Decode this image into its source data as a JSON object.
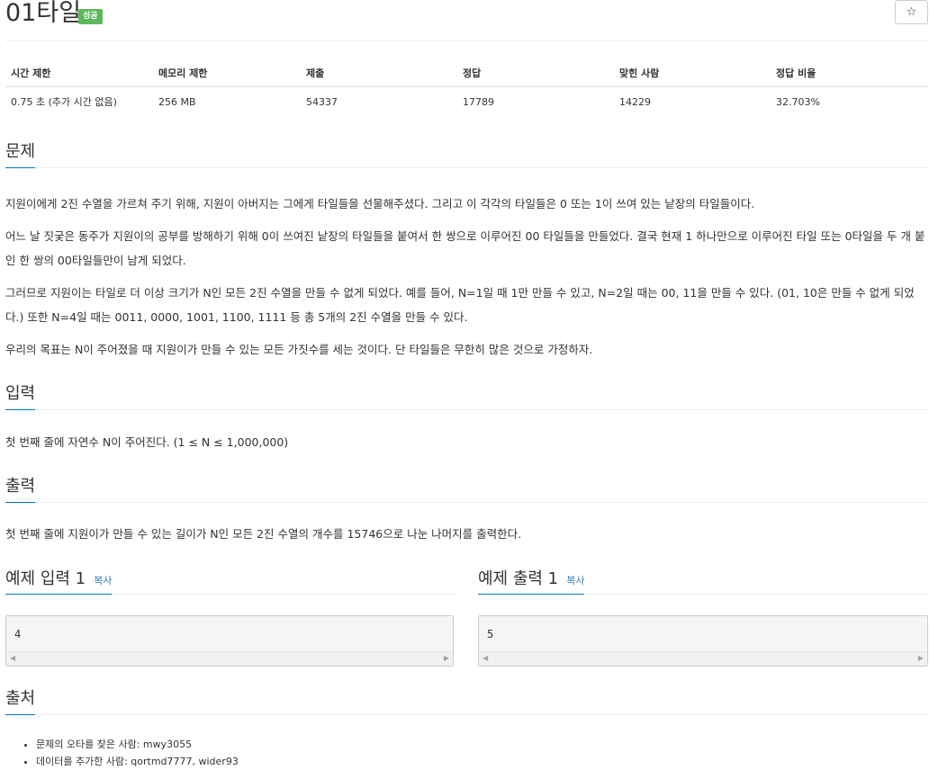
{
  "problem": {
    "title": "01타일",
    "badge": "성공",
    "star_icon": "☆"
  },
  "info": {
    "headers": [
      "시간 제한",
      "메모리 제한",
      "제출",
      "정답",
      "맞힌 사람",
      "정답 비율"
    ],
    "values": [
      "0.75 초 (추가 시간 없음)",
      "256 MB",
      "54337",
      "17789",
      "14229",
      "32.703%"
    ]
  },
  "sections": {
    "problem_title": "문제",
    "problem_paragraphs": [
      "지원이에게 2진 수열을 가르쳐 주기 위해, 지원이 아버지는 그에게 타일들을 선물해주셨다. 그리고 이 각각의 타일들은 0 또는 1이 쓰여 있는 낱장의 타일들이다.",
      "어느 날 짓궂은 동주가 지원이의 공부를 방해하기 위해 0이 쓰여진 낱장의 타일들을 붙여서 한 쌍으로 이루어진 00 타일들을 만들었다. 결국 현재 1 하나만으로 이루어진 타일 또는 0타일을 두 개 붙인 한 쌍의 00타일들만이 남게 되었다.",
      "그러므로 지원이는 타일로 더 이상 크기가 N인 모든 2진 수열을 만들 수 없게 되었다. 예를 들어, N=1일 때 1만 만들 수 있고, N=2일 때는 00, 11을 만들 수 있다. (01, 10은 만들 수 없게 되었다.) 또한 N=4일 때는 0011, 0000, 1001, 1100, 1111 등 총 5개의 2진 수열을 만들 수 있다.",
      "우리의 목표는 N이 주어졌을 때 지원이가 만들 수 있는 모든 가짓수를 세는 것이다. 단 타일들은 무한히 많은 것으로 가정하자."
    ],
    "input_title": "입력",
    "input_text": "첫 번째 줄에 자연수 N이 주어진다. (1 ≤ N ≤ 1,000,000)",
    "output_title": "출력",
    "output_text": "첫 번째 줄에 지원이가 만들 수 있는 길이가 N인 모든 2진 수열의 개수를 15746으로 나눈 나머지를 출력한다.",
    "source_title": "출처"
  },
  "samples": {
    "input_title": "예제 입력 1",
    "output_title": "예제 출력 1",
    "copy_label": "복사",
    "input_value": "4",
    "output_value": "5"
  },
  "source": {
    "items": [
      "문제의 오타를 찾은 사람: mwy3055",
      "데이터를 추가한 사람: qortmd7777, wider93"
    ]
  }
}
